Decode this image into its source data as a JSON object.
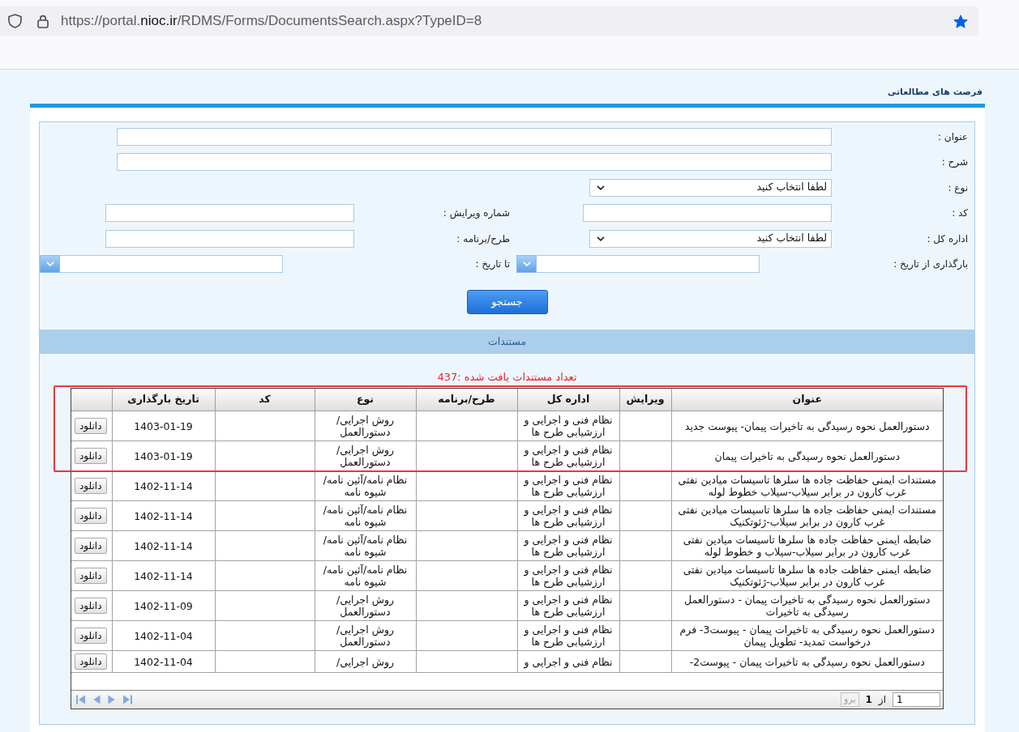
{
  "browser": {
    "url": {
      "prefix": "https://portal.",
      "domain": "nioc.ir",
      "path": "/RDMS/Forms/DocumentsSearch.aspx?TypeID=8"
    },
    "bookmarked": true
  },
  "page_title": "فرصت های مطالعاتی",
  "search_form": {
    "rows": [
      [
        {
          "label": "عنوان :",
          "kind": "text"
        }
      ],
      [
        {
          "label": "شرح :",
          "kind": "text"
        }
      ],
      [
        {
          "label": "نوع :",
          "kind": "select",
          "value": "لطفا انتخاب کنید"
        }
      ],
      [
        {
          "label": "کد :",
          "kind": "text"
        },
        {
          "label": "شماره ویرایش :",
          "kind": "text"
        }
      ],
      [
        {
          "label": "اداره کل :",
          "kind": "select",
          "value": "لطفا انتخاب کنید"
        },
        {
          "label": "طرح/برنامه :",
          "kind": "text"
        }
      ],
      [
        {
          "label": "بارگذاری از تاریخ :",
          "kind": "date"
        },
        {
          "label": "تا تاریخ :",
          "kind": "date"
        }
      ]
    ],
    "submit_button": "جستجو"
  },
  "results_section": {
    "title": "مستندات",
    "count_text": "تعداد مستندات یافت شده :437"
  },
  "table": {
    "header_highlighted": true,
    "columns": [
      "عنوان",
      "ویرایش",
      "اداره کل",
      "طرح/برنامه",
      "نوع",
      "کد",
      "تاریخ بارگذاری"
    ],
    "highlighted_rows": [
      {
        "title": "دستورالعمل نحوه رسیدگی به تاخیرات پیمان- پیوست جدید",
        "department": "نظام فنی و اجرایی و ارزشیابی طرح ها",
        "type": "روش اجرایی/ دستورالعمل",
        "upload_date": "1403-01-19",
        "action": "دانلود"
      },
      {
        "title": "دستورالعمل نحوه رسیدگی به تاخیرات پیمان",
        "department": "نظام فنی و اجرایی و ارزشیابی طرح ها",
        "type": "روش اجرایی/ دستورالعمل",
        "upload_date": "1403-01-19",
        "action": "دانلود"
      }
    ],
    "rows": [
      {
        "title": "مستندات ایمنی حفاظت جاده ها سلرها تاسیسات میادین نفتی غرب کارون در برابر سیلاب-سیلاب خطوط لوله",
        "department": "نظام فنی و اجرایی و ارزشیابی طرح ها",
        "type": "نظام نامه/آئین نامه/ شیوه نامه",
        "upload_date": "1402-11-14",
        "action": "دانلود"
      },
      {
        "title": "مستندات ایمنی حفاظت جاده ها سلرها تاسیسات میادین نفتی غرب کارون در برابر سیلاب-ژئوتکنیک",
        "department": "نظام فنی و اجرایی و ارزشیابی طرح ها",
        "type": "نظام نامه/آئین نامه/ شیوه نامه",
        "upload_date": "1402-11-14",
        "action": "دانلود"
      },
      {
        "title": "ضابطه ایمنی حفاظت جاده ها سلرها تاسیسات میادین نفتی غرب کارون در برابر سیلاب-سیلاب و خطوط لوله",
        "department": "نظام فنی و اجرایی و ارزشیابی طرح ها",
        "type": "نظام نامه/آئین نامه/ شیوه نامه",
        "upload_date": "1402-11-14",
        "action": "دانلود"
      },
      {
        "title": "ضابطه ایمنی حفاظت جاده ها سلرها تاسیسات میادین نفتی غرب کارون در برابر سیلاب-ژئوتکنیک",
        "department": "نظام فنی و اجرایی و ارزشیابی طرح ها",
        "type": "نظام نامه/آئین نامه/ شیوه نامه",
        "upload_date": "1402-11-14",
        "action": "دانلود"
      },
      {
        "title": "دستورالعمل نحوه رسیدگی به تاخیرات پیمان - دستورالعمل رسیدگی به تاخیرات",
        "department": "نظام فنی و اجرایی و ارزشیابی طرح ها",
        "type": "روش اجرایی/ دستورالعمل",
        "upload_date": "1402-11-09",
        "action": "دانلود"
      },
      {
        "title": "دستورالعمل نحوه رسیدگی به تاخیرات پیمان - پیوست3- فرم درخواست تمدید- تطویل پیمان",
        "department": "نظام فنی و اجرایی و ارزشیابی طرح ها",
        "type": "روش اجرایی/ دستورالعمل",
        "upload_date": "1402-11-04",
        "action": "دانلود"
      },
      {
        "title": "دستورالعمل نحوه رسیدگی به تاخیرات پیمان - پیوست2-",
        "department": "نظام فنی و اجرایی و",
        "type": "روش اجرایی/",
        "upload_date": "1402-11-04",
        "action": "دانلود"
      }
    ]
  },
  "pager": {
    "page_field": "1",
    "of_label": "از",
    "total_pages": "1",
    "go_button": "برو",
    "go_disabled": true
  }
}
